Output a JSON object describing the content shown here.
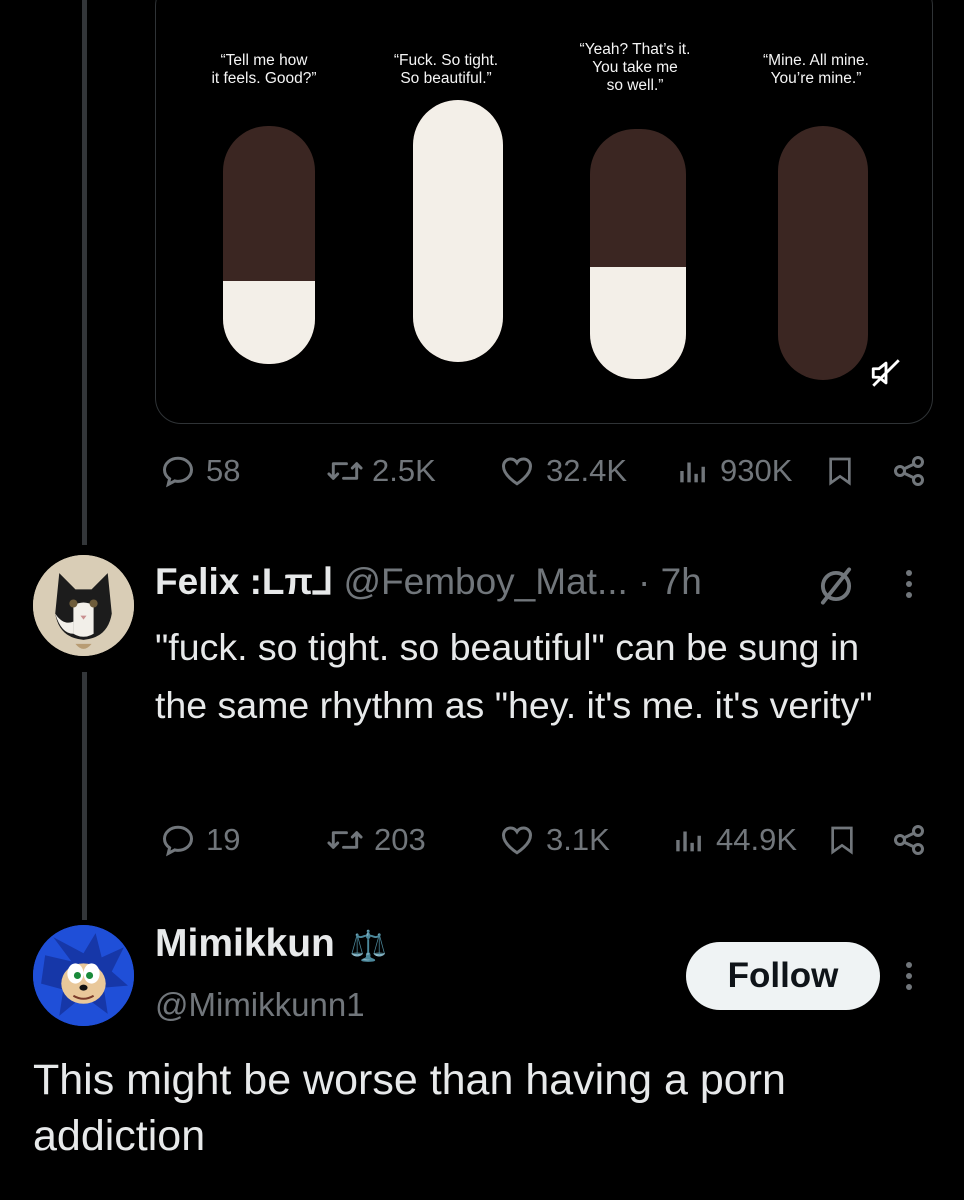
{
  "tweet": {
    "media": {
      "captions": [
        "“Tell me how\nit feels. Good?”",
        "“Fuck. So tight.\nSo beautiful.”",
        "“Yeah? That’s it.\nYou take me\nso well.”",
        "“Mine. All mine.\nYou’re mine.”"
      ],
      "fill_levels": [
        0.35,
        1.0,
        0.45,
        0.0
      ],
      "colors": {
        "pill_empty": "#3b2622",
        "pill_fill": "#f3efe8"
      },
      "mute_icon": "speaker-muted-icon"
    },
    "actions": {
      "replies": "58",
      "retweets": "2.5K",
      "likes": "32.4K",
      "views": "930K"
    }
  },
  "reply": {
    "name": "Felix :Lπ⅃",
    "handle": "@Femboy_Mat... · 7h",
    "text": "\"fuck. so tight. so beautiful\" can be sung in the same rhythm as \"hey. it's me. it's verity\"",
    "icon": "grok-slash-icon",
    "actions": {
      "replies": "19",
      "retweets": "203",
      "likes": "3.1K",
      "views": "44.9K"
    }
  },
  "quote": {
    "name": "Mimikkun",
    "badge": "⚖️",
    "handle": "@Mimikkunn1",
    "follow_label": "Follow",
    "text": "This might be worse than having a porn addiction"
  },
  "colors": {
    "background": "#000000",
    "text": "#e7e9ea",
    "muted": "#71767b",
    "button_bg": "#eff3f4"
  }
}
